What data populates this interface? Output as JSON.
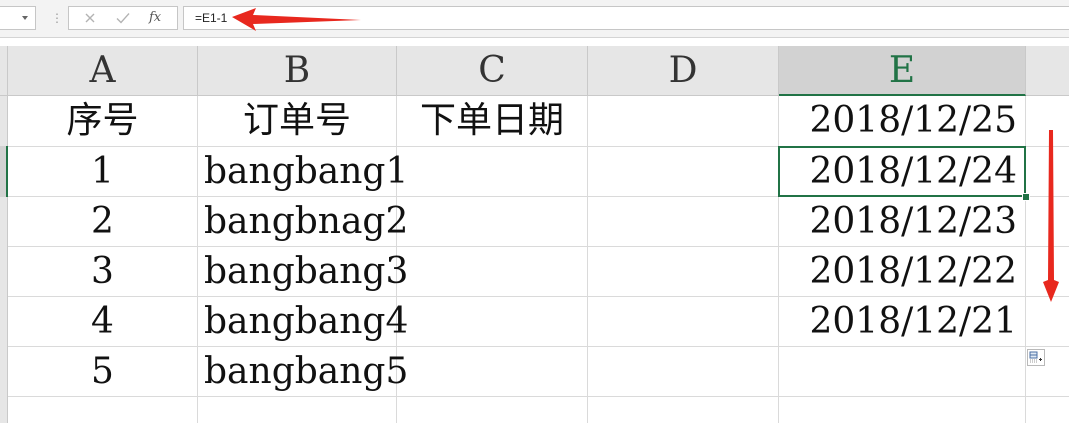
{
  "formula_bar": {
    "name_box": "",
    "formula": "=E1-1",
    "cancel_icon": "close-icon",
    "enter_icon": "check-icon",
    "fx_label": "fx"
  },
  "columns": [
    "A",
    "B",
    "C",
    "D",
    "E"
  ],
  "selected_column": "E",
  "rows": [
    {
      "a": "序号",
      "b": "订单号",
      "c": "下单日期",
      "d": "",
      "e": "2018/12/25"
    },
    {
      "a": "1",
      "b": "bangbang1",
      "c": "",
      "d": "",
      "e": "2018/12/24"
    },
    {
      "a": "2",
      "b": "bangbnag2",
      "c": "",
      "d": "",
      "e": "2018/12/23"
    },
    {
      "a": "3",
      "b": "bangbang3",
      "c": "",
      "d": "",
      "e": "2018/12/22"
    },
    {
      "a": "4",
      "b": "bangbang4",
      "c": "",
      "d": "",
      "e": "2018/12/21"
    },
    {
      "a": "5",
      "b": "bangbang5",
      "c": "",
      "d": "",
      "e": ""
    }
  ],
  "active_cell": "E2",
  "annotation_color": "#e8281e",
  "selection_color": "#217346"
}
